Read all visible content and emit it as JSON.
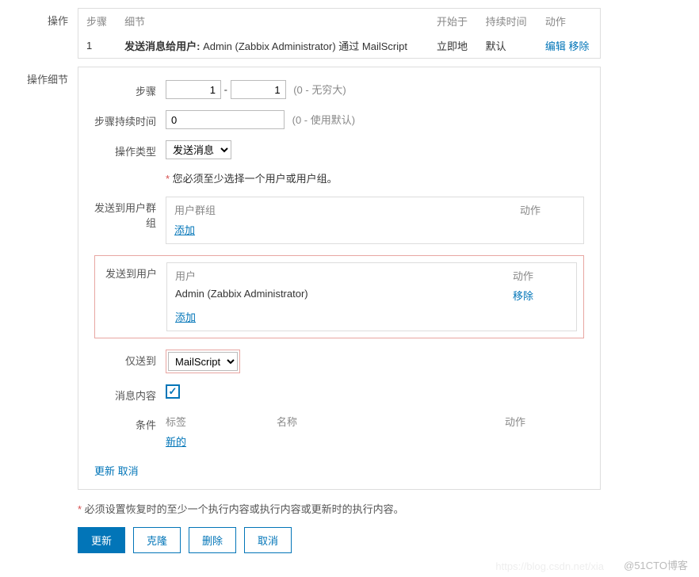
{
  "operations": {
    "label": "操作",
    "headers": {
      "steps": "步骤",
      "details": "细节",
      "start_at": "开始于",
      "duration": "持续时间",
      "action": "动作"
    },
    "row": {
      "step": "1",
      "summary_prefix": "发送消息给用户:",
      "summary_rest": " Admin (Zabbix Administrator) 通过 MailScript",
      "start_at": "立即地",
      "duration": "默认",
      "edit": "编辑",
      "remove": "移除"
    }
  },
  "details": {
    "label": "操作细节",
    "steps_label": "步骤",
    "step_from": "1",
    "step_to": "1",
    "steps_hint": "(0 - 无穷大)",
    "step_duration_label": "步骤持续时间",
    "step_duration_value": "0",
    "step_duration_hint": "(0 - 使用默认)",
    "op_type_label": "操作类型",
    "op_type_value": "发送消息",
    "must_select_note": "您必须至少选择一个用户或用户组。",
    "send_to_groups_label": "发送到用户群组",
    "groups_header": "用户群组",
    "action_header": "动作",
    "add_text": "添加",
    "send_to_users_label": "发送到用户",
    "users_header": "用户",
    "user_value": "Admin (Zabbix Administrator)",
    "remove_text": "移除",
    "only_send_to_label": "仅送到",
    "only_send_to_value": "MailScript",
    "msg_content_label": "消息内容",
    "conditions_label": "条件",
    "cond_headers": {
      "tag": "标签",
      "name": "名称",
      "action": "动作"
    },
    "new_text": "新的",
    "update_text": "更新",
    "cancel_text": "取消"
  },
  "note_text": "必须设置恢复时的至少一个执行内容或执行内容或更新时的执行内容。",
  "buttons": {
    "update": "更新",
    "clone": "克隆",
    "delete": "删除",
    "cancel": "取消"
  },
  "watermark": "@51CTO博客",
  "watermark2": "https://blog.csdn.net/xia"
}
